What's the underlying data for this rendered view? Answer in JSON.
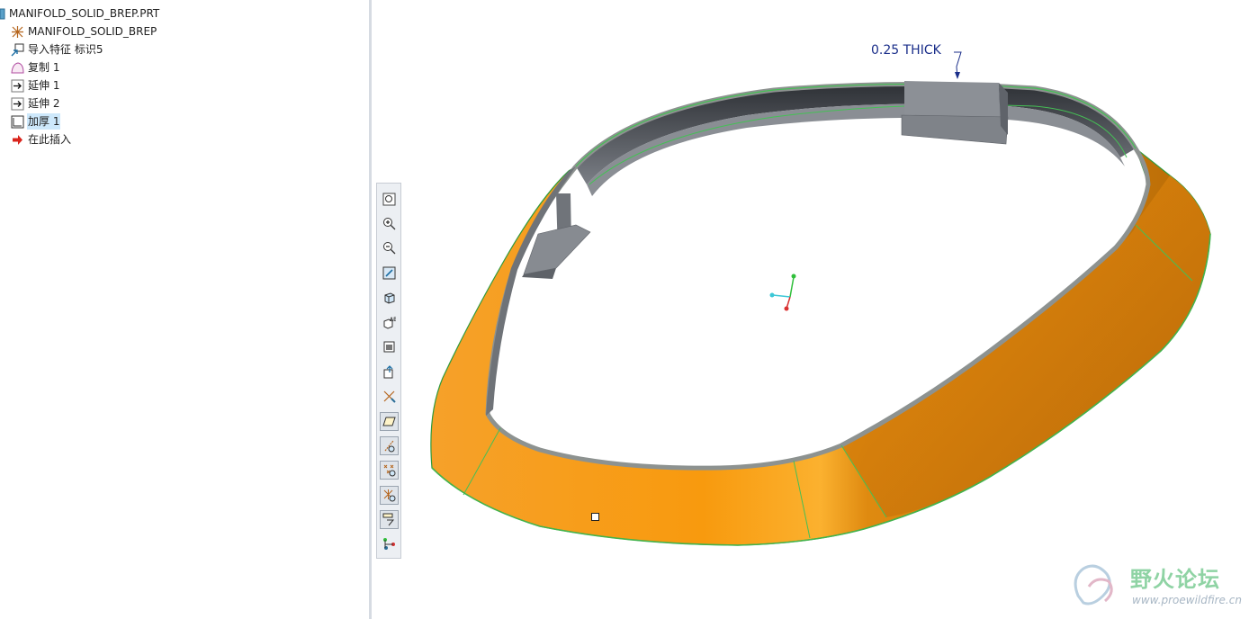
{
  "model_tree": {
    "root": "MANIFOLD_SOLID_BREP.PRT",
    "items": [
      {
        "label": "MANIFOLD_SOLID_BREP",
        "icon": "coordinate-system-icon"
      },
      {
        "label": "导入特征 标识5",
        "icon": "import-feature-icon"
      },
      {
        "label": "复制 1",
        "icon": "copy-surface-icon"
      },
      {
        "label": "延伸 1",
        "icon": "extend-icon"
      },
      {
        "label": "延伸 2",
        "icon": "extend-icon"
      },
      {
        "label": "加厚 1",
        "icon": "thicken-icon",
        "selected": true
      },
      {
        "label": "在此插入",
        "icon": "insert-here-arrow-icon"
      }
    ]
  },
  "viewport": {
    "dimension_note": "0.25 THICK",
    "colors": {
      "solid": "#f29a14",
      "wall": "#7d8086",
      "edge": "#39c24a",
      "note": "#1a2e8a"
    }
  },
  "toolbar": {
    "buttons": [
      "refit-icon",
      "zoom-in-icon",
      "zoom-out-icon",
      "repaint-icon",
      "orient-icon",
      "saved-views-icon",
      "layers-icon",
      "spin-center-icon",
      "datum-display-icon",
      "plane-display-icon",
      "axis-display-icon",
      "point-display-icon",
      "csys-display-icon",
      "annotation-display-icon",
      "simulation-icon"
    ]
  },
  "watermark": {
    "name": "野火论坛",
    "url": "www.proewildfire.cn"
  }
}
